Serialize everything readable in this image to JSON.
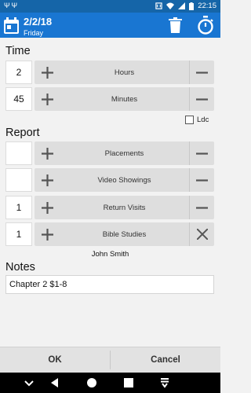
{
  "status_bar": {
    "time": "22:15"
  },
  "header": {
    "date": "2/2/18",
    "day": "Friday"
  },
  "time_section": {
    "title": "Time",
    "rows": [
      {
        "value": "2",
        "label": "Hours"
      },
      {
        "value": "45",
        "label": "Minutes"
      }
    ],
    "ldc_label": "Ldc"
  },
  "report_section": {
    "title": "Report",
    "rows": [
      {
        "value": "",
        "label": "Placements"
      },
      {
        "value": "",
        "label": "Video Showings"
      },
      {
        "value": "1",
        "label": "Return Visits"
      },
      {
        "value": "1",
        "label": "Bible Studies"
      }
    ],
    "student_name": "John Smith"
  },
  "notes_section": {
    "title": "Notes",
    "value": "Chapter 2 $1-8"
  },
  "footer": {
    "ok_label": "OK",
    "cancel_label": "Cancel"
  },
  "colors": {
    "statusbar": "#1565a8",
    "appbar": "#1976d2",
    "background": "#f2f2f2",
    "row_bar": "#dedede"
  }
}
